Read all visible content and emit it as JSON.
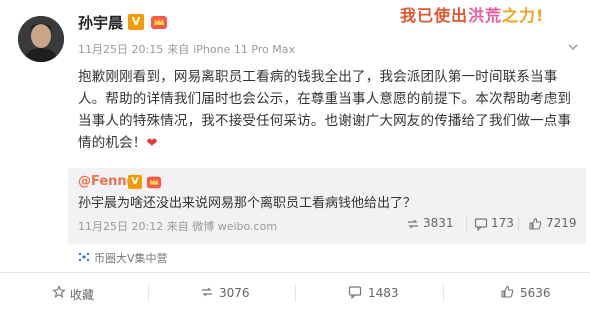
{
  "post": {
    "author": "孙宇晨",
    "v_badge": "V",
    "time": "11月25日 20:15",
    "source_prefix": "来自",
    "device": "iPhone 11 Pro Max",
    "content": "抱歉刚刚看到，网易离职员工看病的钱我全出了，我会派团队第一时间联系当事人。帮助的详情我们届时也会公示，在尊重当事人意愿的前提下。本次帮助考虑到当事人的特殊情况，我不接受任何采访。也谢谢广大网友的传播给了我们做一点事情的机会！",
    "heart": "❤"
  },
  "slogan": {
    "part1": "我已使出",
    "part2": "洪荒",
    "part3": "之力!"
  },
  "quoted": {
    "author": "@Fenng",
    "v_badge": "V",
    "text": "孙宇晨为啥还没出来说网易那个离职员工看病钱他给出了？",
    "time": "11月25日 20:12",
    "source_prefix": "来自",
    "device": "微博 weibo.com",
    "reposts": "3831",
    "comments": "173",
    "likes": "7219"
  },
  "source_label": "币圈大V集中营",
  "actions": {
    "favorite": "收藏",
    "repost": "3076",
    "comment": "1483",
    "like": "5636"
  },
  "colors": {
    "accent": "#eb7350",
    "heart": "#e53935",
    "v_badge": "#f59a00"
  }
}
